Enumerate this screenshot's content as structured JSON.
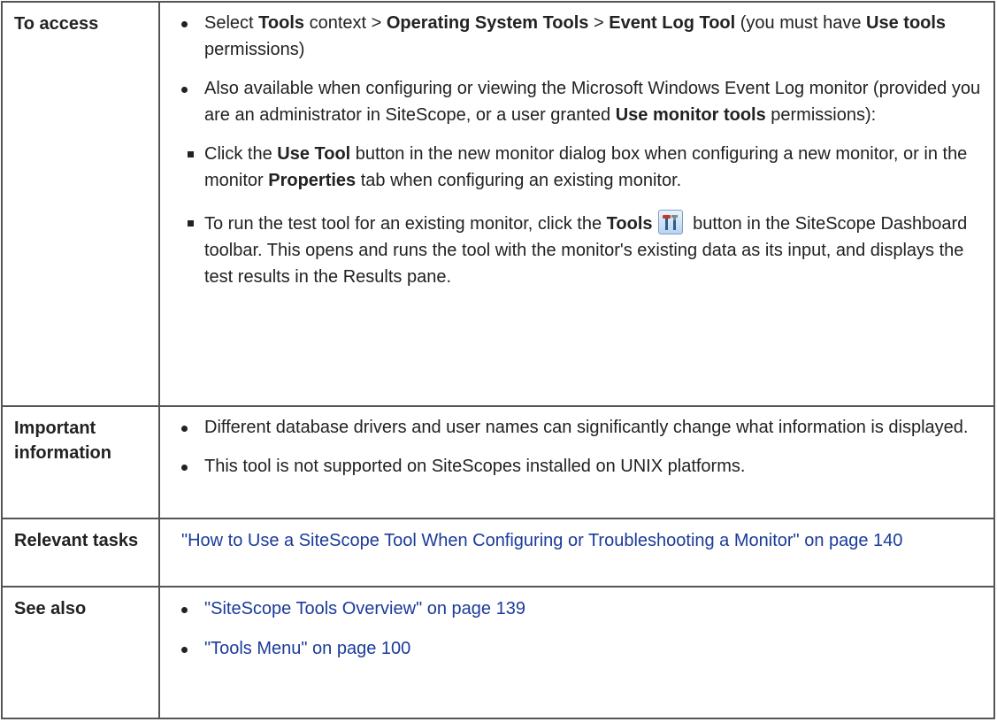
{
  "rows": {
    "access": {
      "header": "To access",
      "bullet1": {
        "t1": "Select ",
        "b1": "Tools",
        "t2": " context > ",
        "b2": "Operating System Tools",
        "t3": " > ",
        "b3": "Event Log Tool",
        "t4": " (you must have ",
        "b4": "Use tools",
        "t5": " permissions)"
      },
      "bullet2": {
        "t1": "Also available when configuring or viewing the Microsoft Windows Event Log monitor (provided you are an administrator in SiteScope, or a user granted ",
        "b1": "Use monitor tools",
        "t2": " permissions):"
      },
      "sub1": {
        "t1": "Click the ",
        "b1": "Use Tool",
        "t2": " button in the new monitor dialog box when configuring a new monitor, or in the monitor ",
        "b2": "Properties",
        "t3": " tab when configuring an existing monitor."
      },
      "sub2": {
        "t1": "To run the test tool for an existing monitor, click the ",
        "b1": "Tools",
        "t2": " button in the SiteScope Dashboard toolbar. This opens and runs the tool with the monitor's existing data as its input, and displays the test results in the Results pane."
      }
    },
    "important": {
      "header": "Important information",
      "bullet1": "Different database drivers and user names can significantly change what information is displayed.",
      "bullet2": "This tool is not supported on SiteScopes installed on UNIX platforms."
    },
    "tasks": {
      "header": "Relevant tasks",
      "link": "\"How to Use a SiteScope Tool When Configuring or Troubleshooting a Monitor\" on page 140"
    },
    "see_also": {
      "header": "See also",
      "link1": "\"SiteScope Tools Overview\" on page 139",
      "link2": "\"Tools Menu\" on page 100"
    }
  },
  "icons": {
    "tools_button": "tools-icon"
  }
}
